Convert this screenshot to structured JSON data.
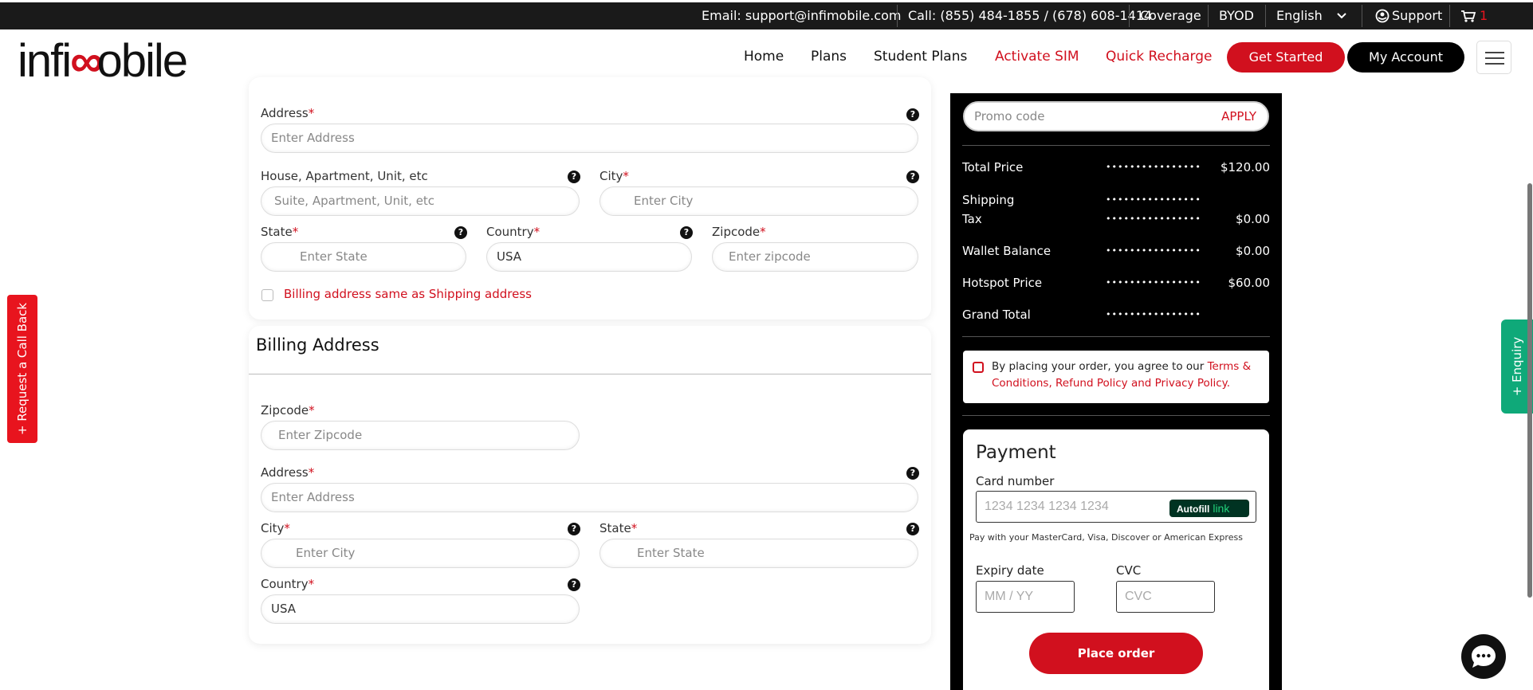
{
  "topbar": {
    "email": "Email: support@infimobile.com",
    "call": "Call: (855) 484-1855 / (678) 608-1414",
    "coverage": "Coverage",
    "byod": "BYOD",
    "language": "English",
    "support": "Support",
    "cart_count": "1"
  },
  "nav": {
    "logo_left": "infi",
    "logo_mid": "∞",
    "logo_right": "obile",
    "home": "Home",
    "plans": "Plans",
    "student_plans": "Student Plans",
    "activate_sim": "Activate SIM",
    "quick_recharge": "Quick Recharge",
    "get_started": "Get Started",
    "my_account": "My Account"
  },
  "shipping": {
    "address_label": "Address",
    "address_placeholder": "Enter Address",
    "house_label": "House, Apartment, Unit, etc",
    "house_placeholder": "Suite, Apartment, Unit, etc",
    "city_label": "City",
    "city_placeholder": "Enter City",
    "state_label": "State",
    "state_placeholder": "Enter State",
    "country_label": "Country",
    "country_value": "USA",
    "zipcode_label": "Zipcode",
    "zipcode_placeholder": "Enter zipcode",
    "billing_same": "Billing address same as Shipping address"
  },
  "billing": {
    "title": "Billing Address",
    "zipcode_label": "Zipcode",
    "zipcode_placeholder": "Enter Zipcode",
    "address_label": "Address",
    "address_placeholder": "Enter Address",
    "city_label": "City",
    "city_placeholder": "Enter City",
    "state_label": "State",
    "state_placeholder": "Enter State",
    "country_label": "Country",
    "country_value": "USA"
  },
  "required_mark": "*",
  "help_glyph": "?",
  "summary": {
    "promo_placeholder": "Promo code",
    "apply": "APPLY",
    "dots": "••••••••••••••••",
    "rows": [
      {
        "label": "Total Price",
        "value": "$120.00"
      },
      {
        "label": "Shipping",
        "value": ""
      },
      {
        "label": "Tax",
        "value": "$0.00"
      },
      {
        "label": "Wallet Balance",
        "value": "$0.00"
      },
      {
        "label": "Hotspot Price",
        "value": "$60.00"
      },
      {
        "label": "Grand Total",
        "value": ""
      }
    ],
    "terms_prefix": "By placing your order, you agree to our ",
    "terms_link": "Terms & Conditions, Refund Policy and Privacy Policy."
  },
  "payment": {
    "title": "Payment",
    "card_label": "Card number",
    "card_placeholder": "1234 1234 1234 1234",
    "autofill": "Autofill",
    "link": "link",
    "hint": "Pay with your MasterCard, Visa, Discover or American Express",
    "expiry_label": "Expiry date",
    "expiry_placeholder": "MM / YY",
    "cvc_label": "CVC",
    "cvc_placeholder": "CVC",
    "place_order": "Place order"
  },
  "widgets": {
    "callback": "+ Request a Call Back",
    "enquiry": "+ Enquiry"
  }
}
